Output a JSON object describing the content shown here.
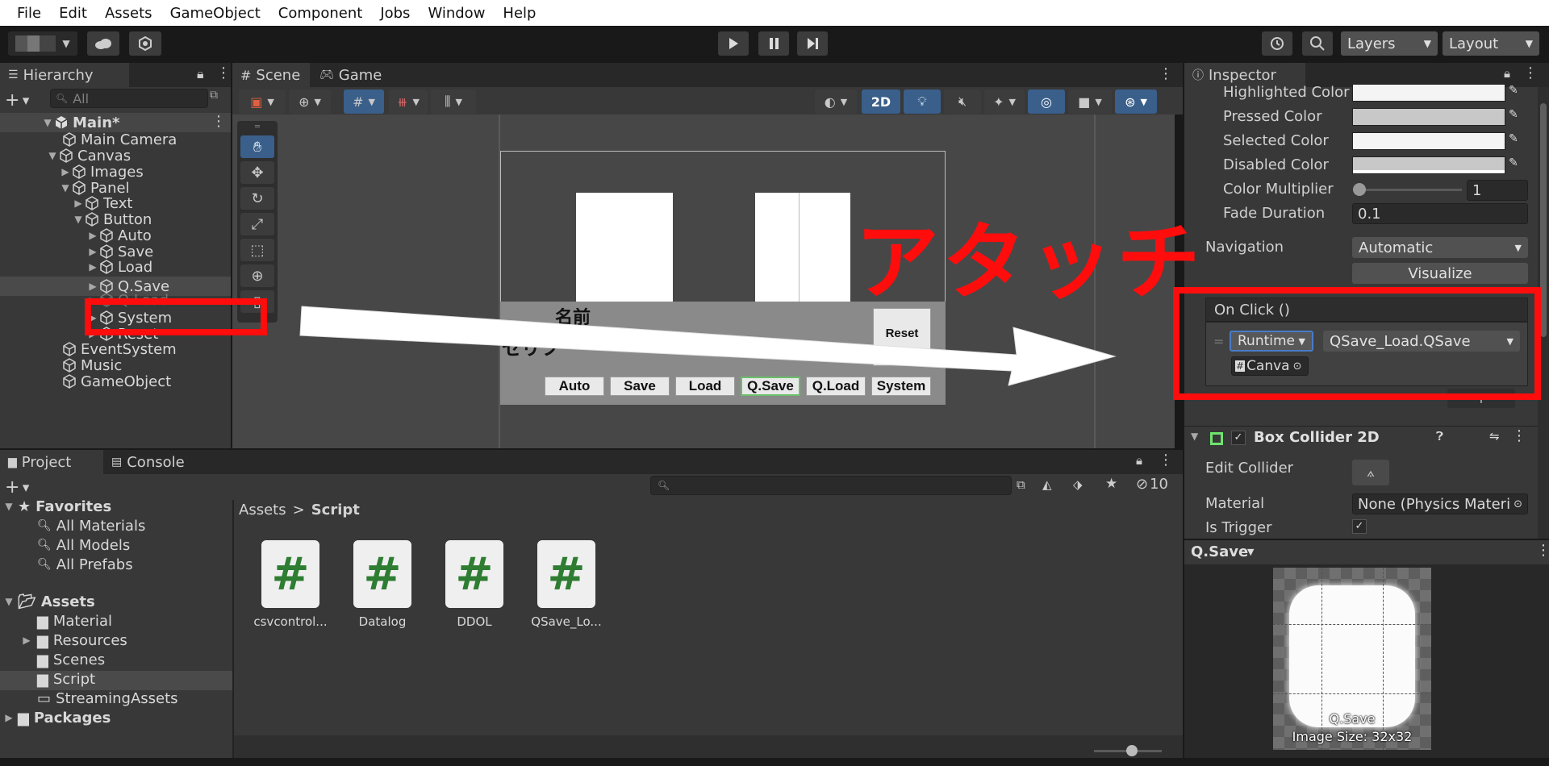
{
  "menu": [
    "File",
    "Edit",
    "Assets",
    "GameObject",
    "Component",
    "Jobs",
    "Window",
    "Help"
  ],
  "toolbar": {
    "layers_label": "Layers",
    "layout_label": "Layout"
  },
  "hierarchy": {
    "title": "Hierarchy",
    "search_placeholder": "All",
    "scene": "Main*",
    "items": [
      "Main Camera",
      "Canvas",
      "Images",
      "Panel",
      "Text",
      "Button",
      "Auto",
      "Save",
      "Load",
      "Q.Save",
      "Q.Load",
      "System",
      "Reset",
      "EventSystem",
      "Music",
      "GameObject"
    ]
  },
  "scene_tabs": {
    "scene": "Scene",
    "game": "Game"
  },
  "scene_view": {
    "mode_2d": "2D",
    "name_label": "名前",
    "dialog_label": "セリフ",
    "reset_label": "Reset",
    "buttons": [
      "Auto",
      "Save",
      "Load",
      "Q.Save",
      "Q.Load",
      "System"
    ]
  },
  "inspector": {
    "title": "Inspector",
    "highlighted_color": "Highlighted Color",
    "pressed_color": "Pressed Color",
    "selected_color": "Selected Color",
    "disabled_color": "Disabled Color",
    "color_multiplier": "Color Multiplier",
    "color_multiplier_value": "1",
    "fade_duration": "Fade Duration",
    "fade_duration_value": "0.1",
    "navigation": "Navigation",
    "navigation_value": "Automatic",
    "visualize": "Visualize",
    "on_click": "On Click ()",
    "runtime": "Runtime",
    "function": "QSave_Load.QSave",
    "target": "Canva",
    "box_collider": "Box Collider 2D",
    "edit_collider": "Edit Collider",
    "material": "Material",
    "material_value": "None (Physics Materi",
    "is_trigger": "Is Trigger"
  },
  "annotation": {
    "text": "アタッチ",
    "color": "#ff0d0d"
  },
  "preview": {
    "name": "Q.Save",
    "caption": "Q.Save",
    "size": "Image Size: 32x32"
  },
  "project": {
    "tab_project": "Project",
    "tab_console": "Console",
    "hidden_count": "10",
    "breadcrumb_root": "Assets",
    "breadcrumb_current": "Script",
    "favorites": "Favorites",
    "favorite_items": [
      "All Materials",
      "All Models",
      "All Prefabs"
    ],
    "assets_root": "Assets",
    "folders": [
      "Material",
      "Resources",
      "Scenes",
      "Script",
      "StreamingAssets"
    ],
    "packages": "Packages",
    "files": [
      "csvcontrol...",
      "Datalog",
      "DDOL",
      "QSave_Lo..."
    ]
  }
}
